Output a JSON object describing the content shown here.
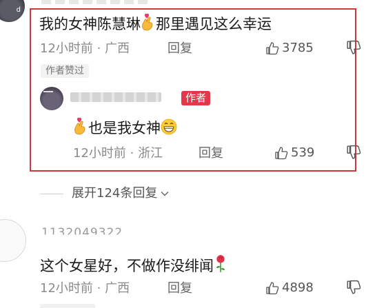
{
  "comment1": {
    "text": "我的女神陈慧琳",
    "text_after_emoji": "那里遇见这么幸运",
    "time": "12小时前 · 广西",
    "reply_label": "回复",
    "likes": "3785",
    "author_badge": "作者赞过"
  },
  "reply1": {
    "author_tag": "作者",
    "text": "也是我女神",
    "time": "12小时前 · 浙江",
    "reply_label": "回复",
    "likes": "539"
  },
  "expand": {
    "label": "展开124条回复"
  },
  "comment2": {
    "username": "1132049322",
    "text": "这个女星好，不做作没绯闻",
    "time": "12小时前 · 广西",
    "reply_label": "回复",
    "likes": "4898"
  },
  "icons": {
    "like": "thumbs-up-outline-icon",
    "dislike": "thumbs-down-outline-icon",
    "crossed_fingers": "crossed-fingers-heart-emoji",
    "grin": "grinning-face-emoji",
    "rose": "rose-emoji",
    "chevron": "chevron-down-icon"
  },
  "colors": {
    "highlight_border": "#d0383c",
    "author_tag_bg": "#e3384a",
    "meta_text": "#8a8a8a"
  }
}
